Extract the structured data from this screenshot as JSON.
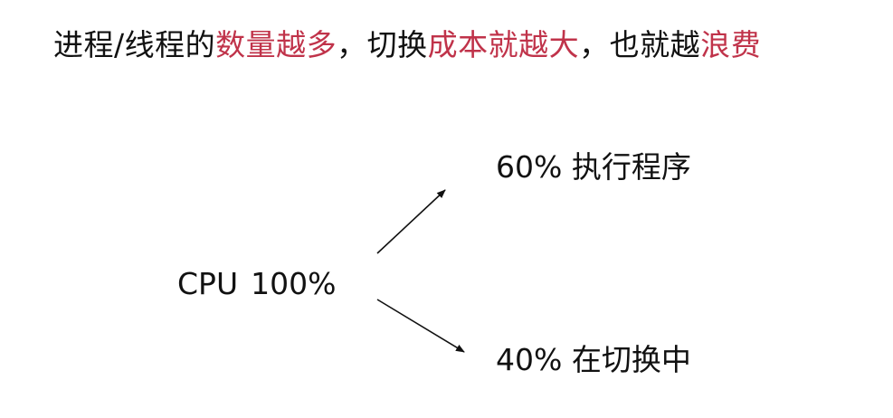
{
  "title": {
    "p1": "进程/线程的",
    "h1": "数量越多",
    "p2": "，切换",
    "h2": "成本就越大",
    "p3": "，也就越",
    "h3": "浪费",
    "highlight_color": "#c0334a"
  },
  "cpu": {
    "label": "CPU",
    "value": "100%"
  },
  "branches": [
    {
      "percent": "60%",
      "label": "执行程序"
    },
    {
      "percent": "40%",
      "label": "在切换中"
    }
  ]
}
